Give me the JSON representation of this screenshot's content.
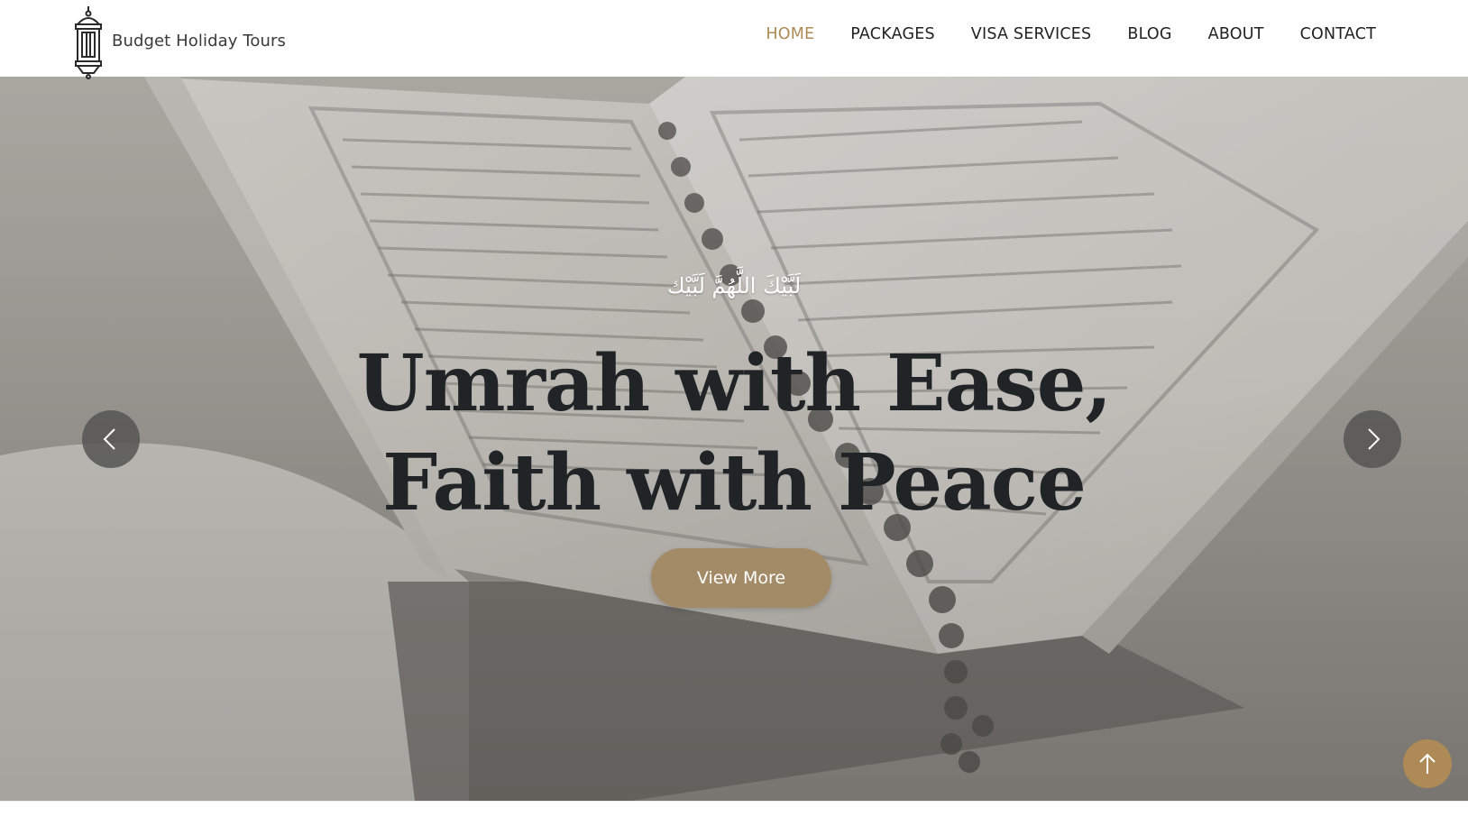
{
  "brand": {
    "name": "Budget Holiday Tours",
    "logo_icon": "lantern-icon"
  },
  "nav": {
    "items": [
      {
        "label": "HOME",
        "active": true
      },
      {
        "label": "PACKAGES",
        "active": false
      },
      {
        "label": "VISA SERVICES",
        "active": false
      },
      {
        "label": "BLOG",
        "active": false
      },
      {
        "label": "ABOUT",
        "active": false
      },
      {
        "label": "CONTACT",
        "active": false
      }
    ]
  },
  "hero": {
    "arabic_text": "لَبَّيْكَ اللَّهُمَّ لَبَّيْك",
    "title_line1": "Umrah with Ease,",
    "title_line2": "Faith with Peace",
    "cta_label": "View More",
    "background_icon": "quran-book-image",
    "prev_icon": "chevron-left-icon",
    "next_icon": "chevron-right-icon"
  },
  "back_to_top_icon": "arrow-up-icon",
  "colors": {
    "accent": "#ad8a56",
    "title": "#1f2428",
    "nav_text": "#222222",
    "carousel_button": "#555555"
  }
}
